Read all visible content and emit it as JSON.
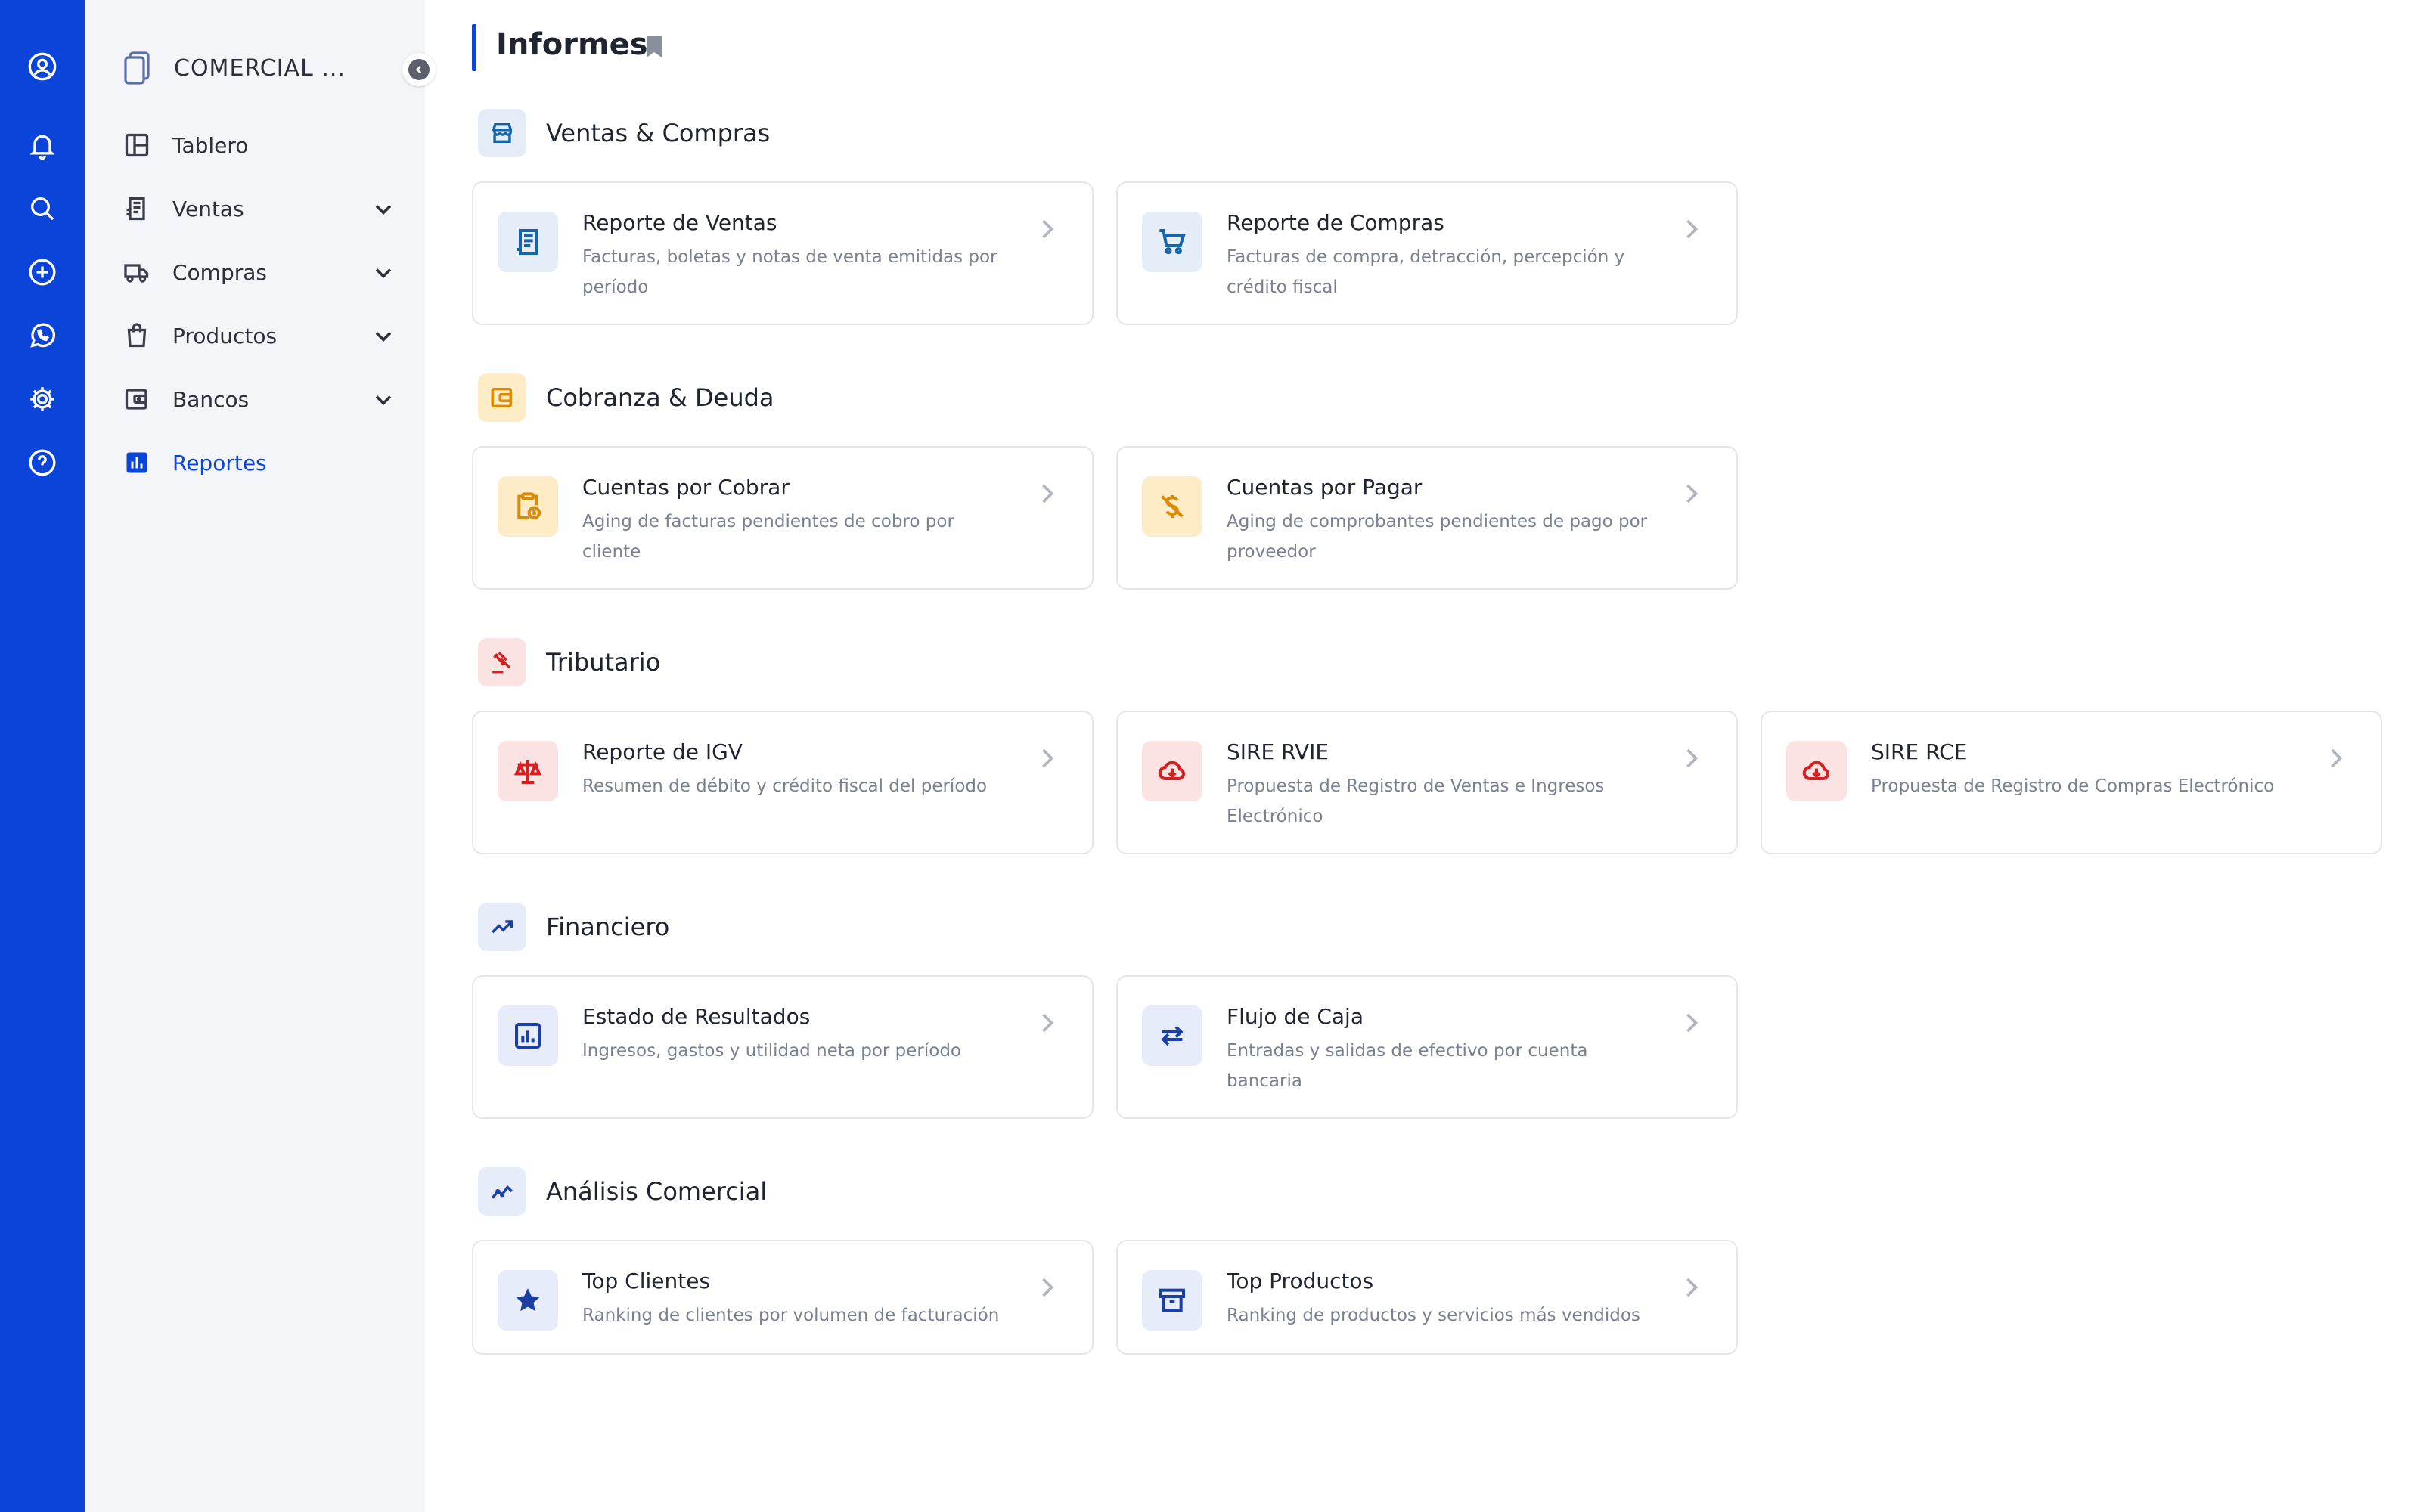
{
  "colors": {
    "rail": "#0a44d8",
    "active": "#0a44d8",
    "sidebar_bg": "#f4f5f9"
  },
  "rail": {
    "icons": [
      "user-circle-icon",
      "bell-icon",
      "search-icon",
      "plus-circle-icon",
      "whatsapp-icon",
      "gear-icon",
      "help-circle-icon"
    ]
  },
  "sidebar": {
    "company_name": "COMERCIAL ...",
    "items": [
      {
        "label": "Tablero",
        "icon": "layout-icon"
      },
      {
        "label": "Ventas",
        "icon": "receipt-icon"
      },
      {
        "label": "Compras",
        "icon": "truck-icon"
      },
      {
        "label": "Productos",
        "icon": "bag-icon"
      },
      {
        "label": "Bancos",
        "icon": "wallet-icon"
      },
      {
        "label": "Reportes",
        "icon": "bar-chart-icon",
        "active": true
      }
    ]
  },
  "page": {
    "title": "Informes"
  },
  "sections": [
    {
      "title": "Ventas & Compras",
      "icon": "store-icon",
      "cards": [
        {
          "title": "Reporte de Ventas",
          "desc": "Facturas, boletas y notas de venta emitidas por período",
          "icon": "receipt-icon"
        },
        {
          "title": "Reporte de Compras",
          "desc": "Facturas de compra, detracción, percepción y crédito fiscal",
          "icon": "cart-icon"
        }
      ]
    },
    {
      "title": "Cobranza & Deuda",
      "icon": "wallet-icon",
      "cards": [
        {
          "title": "Cuentas por Cobrar",
          "desc": "Aging de facturas pendientes de cobro por cliente",
          "icon": "clipboard-clock-icon"
        },
        {
          "title": "Cuentas por Pagar",
          "desc": "Aging de comprobantes pendientes de pago por proveedor",
          "icon": "dollar-off-icon"
        }
      ]
    },
    {
      "title": "Tributario",
      "icon": "gavel-icon",
      "cards": [
        {
          "title": "Reporte de IGV",
          "desc": "Resumen de débito y crédito fiscal del período",
          "icon": "scale-icon"
        },
        {
          "title": "SIRE RVIE",
          "desc": "Propuesta de Registro de Ventas e Ingresos Electrónico",
          "icon": "cloud-download-icon"
        },
        {
          "title": "SIRE RCE",
          "desc": "Propuesta de Registro de Compras Electrónico",
          "icon": "cloud-download-icon"
        }
      ]
    },
    {
      "title": "Financiero",
      "icon": "trending-up-icon",
      "cards": [
        {
          "title": "Estado de Resultados",
          "desc": "Ingresos, gastos y utilidad neta por período",
          "icon": "chart-box-icon"
        },
        {
          "title": "Flujo de Caja",
          "desc": "Entradas y salidas de efectivo por cuenta bancaria",
          "icon": "swap-arrows-icon"
        }
      ]
    },
    {
      "title": "Análisis Comercial",
      "icon": "analytics-icon",
      "cards": [
        {
          "title": "Top Clientes",
          "desc": "Ranking de clientes por volumen de facturación",
          "icon": "star-icon"
        },
        {
          "title": "Top Productos",
          "desc": "Ranking de productos y servicios más vendidos",
          "icon": "archive-icon"
        }
      ]
    }
  ]
}
